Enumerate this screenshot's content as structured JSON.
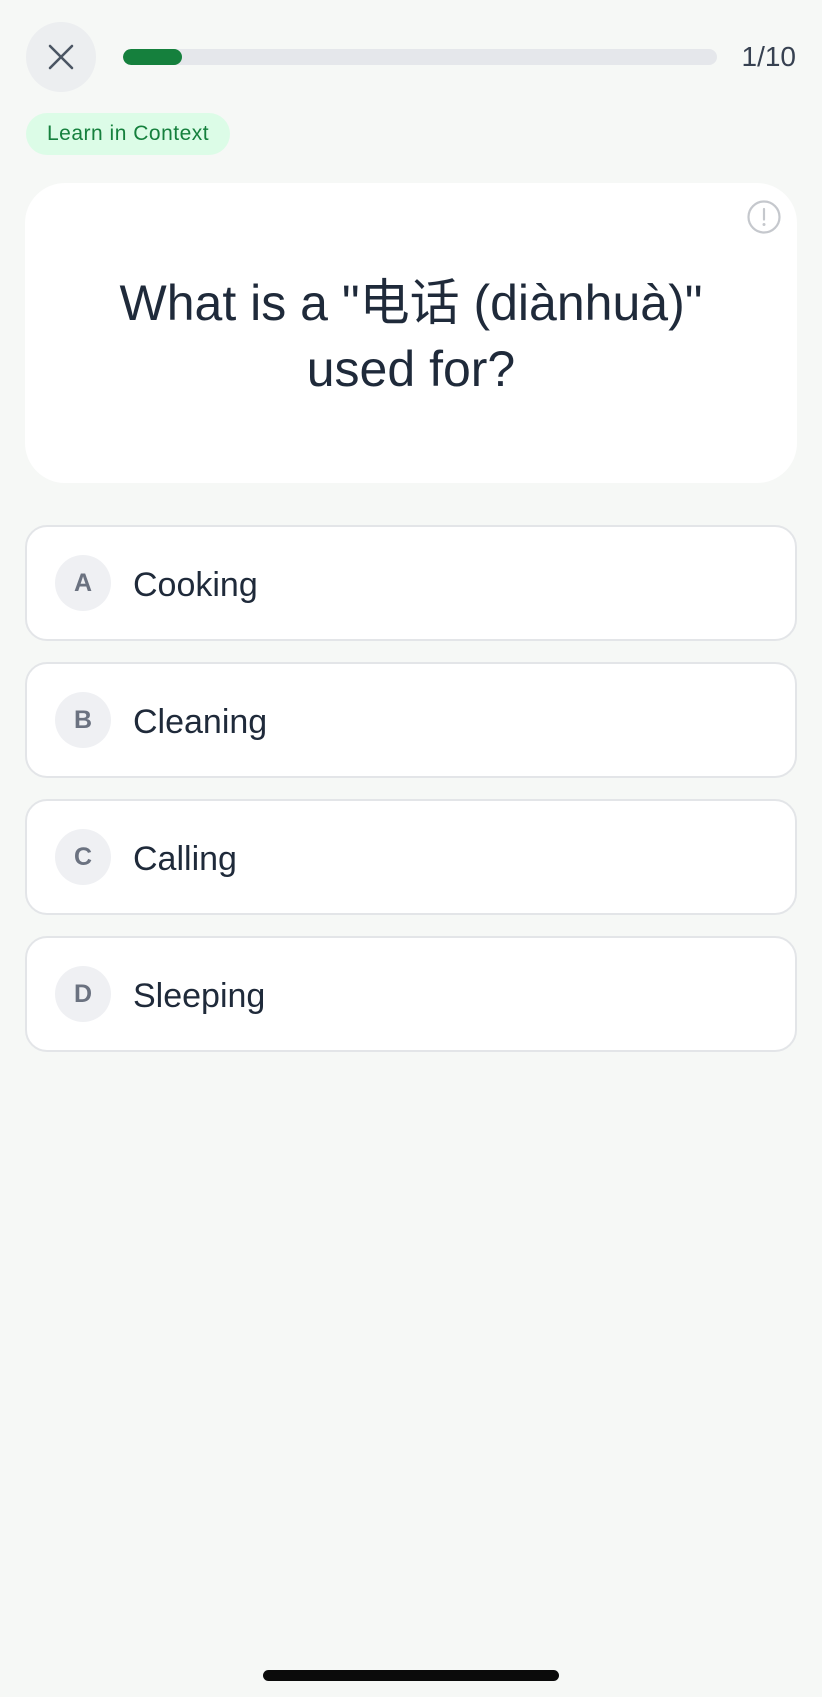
{
  "header": {
    "close_icon": "close-icon",
    "progress": {
      "current": 1,
      "total": 10,
      "label": "1/10",
      "fraction": 0.1,
      "fill_color": "#15803d"
    }
  },
  "badge": {
    "label": "Learn in Context"
  },
  "question": {
    "text": "What is a \"电话 (diànhuà)\" used for?",
    "report_icon": "alert-circle-icon"
  },
  "options": [
    {
      "letter": "A",
      "text": "Cooking"
    },
    {
      "letter": "B",
      "text": "Cleaning"
    },
    {
      "letter": "C",
      "text": "Calling"
    },
    {
      "letter": "D",
      "text": "Sleeping"
    }
  ],
  "colors": {
    "accent": "#15803d",
    "badge_background": "#dcfce7",
    "page_background": "#f6f8f6"
  }
}
